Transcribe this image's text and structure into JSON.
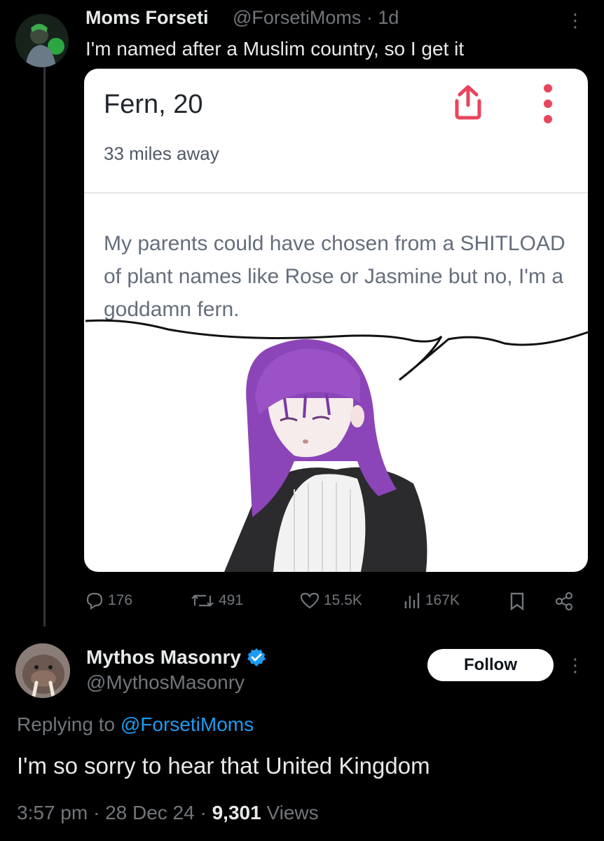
{
  "tweet1": {
    "display_name": "Moms Forseti",
    "handle_time": "@ForsetiMoms · 1d",
    "text": "I'm named after a Muslim country, so I get it",
    "avatar_icon": "avatar-icon",
    "media": {
      "profile_name": "Fern, 20",
      "distance": "33 miles away",
      "bio": "My parents could have chosen from a SHITLOAD of plant names like Rose or Jasmine but no, I'm a goddamn fern.",
      "share_color": "#e8455d",
      "character_hair_color": "#8c45b8"
    },
    "actions": {
      "replies": "176",
      "retweets": "491",
      "likes": "15.5K",
      "views": "167K"
    }
  },
  "tweet2": {
    "display_name": "Mythos Masonry",
    "handle": "@MythosMasonry",
    "verified_color": "#1d9bf0",
    "follow_label": "Follow",
    "replying_prefix": "Replying to",
    "replying_handle": "@ForsetiMoms",
    "text": "I'm so sorry to hear that United Kingdom",
    "time": "3:57 pm",
    "date": "28 Dec 24",
    "views_count": "9,301",
    "views_label": "Views"
  }
}
